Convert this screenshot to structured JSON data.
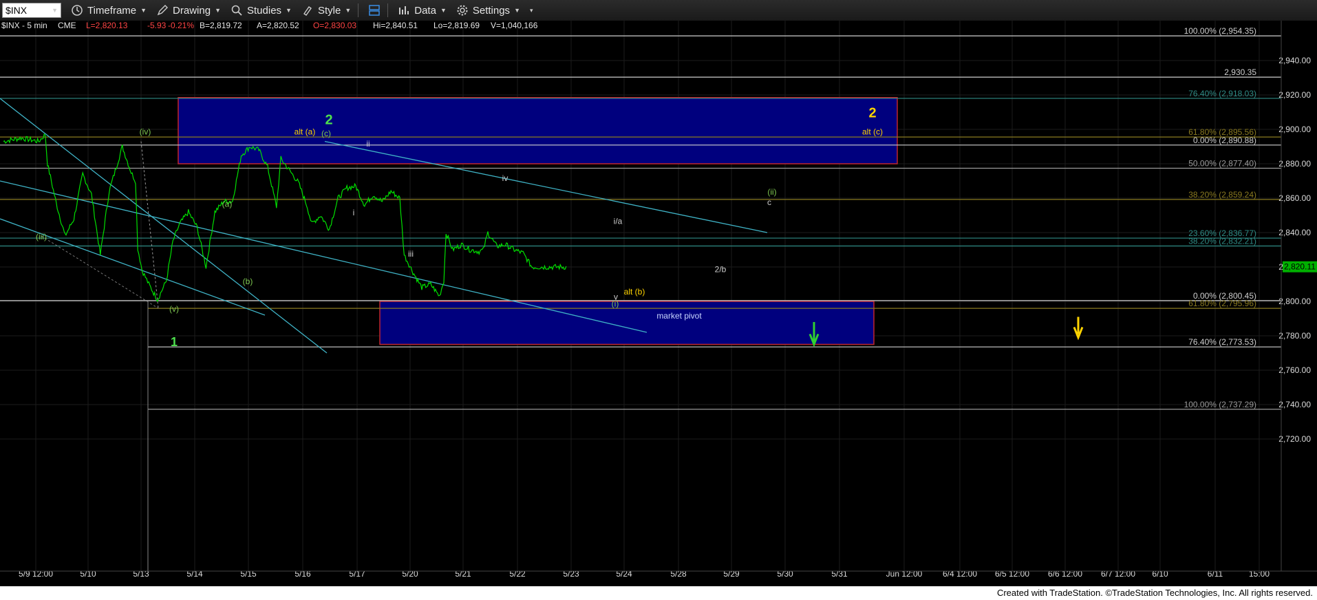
{
  "toolbar": {
    "symbol": "$INX",
    "timeframe": "Timeframe",
    "drawing": "Drawing",
    "studies": "Studies",
    "style": "Style",
    "data": "Data",
    "settings": "Settings"
  },
  "header": {
    "symbol_tf": "$INX - 5 min",
    "exchange": "CME",
    "last": "L=2,820.13",
    "change": "-5.93",
    "pct": "-0.21%",
    "bid": "B=2,819.72",
    "ask": "A=2,820.52",
    "open": "O=2,830.03",
    "high": "Hi=2,840.51",
    "low": "Lo=2,819.69",
    "volume": "V=1,040,166"
  },
  "footer": "Created with TradeStation. ©TradeStation Technologies, Inc. All rights reserved.",
  "colors": {
    "price": "#00e000",
    "trend": "#3fb3c6",
    "box": "#00007e",
    "boxBorder": "#c0262f",
    "fibGray": "#9a9a9a",
    "fibTeal": "#2f8c86",
    "fibOlive": "#8a7a20",
    "fibWhite": "#cfcfcf",
    "green": "#7ec850",
    "yellow": "#ffd400"
  },
  "chart_data": {
    "type": "line",
    "title": "$INX - 5 min",
    "ylim": [
      2705,
      2970
    ],
    "x_ticks": [
      "5/9 12:00",
      "5/10",
      "5/13",
      "5/14",
      "5/15",
      "5/16",
      "5/17",
      "5/20",
      "5/21",
      "5/22",
      "5/23",
      "5/24",
      "5/28",
      "5/29",
      "5/30",
      "5/31",
      "Jun 12:00",
      "6/4 12:00",
      "6/5 12:00",
      "6/6 12:00",
      "6/7 12:00",
      "6/10",
      "6/11",
      "15:00"
    ],
    "y_ticks": [
      2720,
      2740,
      2760,
      2780,
      2800,
      2820,
      2840,
      2860,
      2880,
      2900,
      2920,
      2940
    ],
    "y_tick_labels": [
      "2,720.00",
      "2,740.00",
      "2,760.00",
      "2,780.00",
      "2,800.00",
      "2,820.00",
      "2,840.00",
      "2,860.00",
      "2,880.00",
      "2,900.00",
      "2,920.00",
      "2,940.00"
    ],
    "last_price": 2820.11,
    "last_price_label": "2,820.11",
    "series": [
      {
        "x": [
          0.0,
          0.4,
          0.8,
          0.95,
          1.0,
          1.2,
          1.4,
          1.6,
          1.8,
          2.0,
          2.2,
          2.4,
          2.7,
          2.9,
          3.0,
          3.05,
          3.15,
          3.3,
          3.5,
          3.7,
          3.85,
          4.0,
          4.2,
          4.4,
          4.6,
          4.8,
          5.0,
          5.2,
          5.4,
          5.6,
          5.8,
          6.0,
          6.2,
          6.3,
          6.5,
          6.7,
          6.9,
          7.0,
          7.2,
          7.4,
          7.6,
          7.8,
          8.0,
          8.2,
          8.4,
          8.6,
          8.8,
          9.0,
          9.1,
          9.3,
          9.5,
          9.7,
          9.9,
          10.0,
          10.05,
          10.2,
          10.4,
          10.6,
          10.8,
          10.9,
          11.0,
          11.2,
          11.4,
          11.6,
          11.8,
          12.0,
          12.2,
          12.4,
          12.6,
          12.8
        ],
        "y": [
          2893,
          2895,
          2893,
          2897,
          2880,
          2857,
          2838,
          2848,
          2874,
          2862,
          2827,
          2864,
          2890,
          2875,
          2870,
          2831,
          2818,
          2810,
          2801,
          2812,
          2835,
          2845,
          2852,
          2843,
          2820,
          2852,
          2858,
          2858,
          2885,
          2890,
          2888,
          2878,
          2855,
          2883,
          2876,
          2869,
          2855,
          2845,
          2850,
          2842,
          2860,
          2866,
          2867,
          2856,
          2862,
          2858,
          2864,
          2860,
          2827,
          2817,
          2808,
          2810,
          2803,
          2812,
          2840,
          2830,
          2833,
          2830,
          2829,
          2830,
          2840,
          2832,
          2833,
          2830,
          2828,
          2820,
          2820,
          2820,
          2820,
          2820
        ],
        "x_note": "x positions measured in trading-session units from first plotted bar"
      }
    ],
    "fib_levels": [
      {
        "label": "100.00% (2,954.35)",
        "value": 2954.35
      },
      {
        "label": "2,930.35",
        "value": 2930.35
      },
      {
        "label": "76.40% (2,918.03)",
        "value": 2918.03
      },
      {
        "label": "61.80% (2,895.56)",
        "value": 2895.56
      },
      {
        "label": "0.00% (2,890.88)",
        "value": 2890.88
      },
      {
        "label": "50.00% (2,877.40)",
        "value": 2877.4
      },
      {
        "label": "38.20% (2,859.24)",
        "value": 2859.24
      },
      {
        "label": "23.60% (2,836.77)",
        "value": 2836.77
      },
      {
        "label": "38.20% (2,832.21)",
        "value": 2832.21
      },
      {
        "label": "0.00% (2,800.45)",
        "value": 2800.45
      },
      {
        "label": "61.80% (2,795.96)",
        "value": 2795.96
      },
      {
        "label": "76.40% (2,773.53)",
        "value": 2773.53
      },
      {
        "label": "100.00% (2,737.29)",
        "value": 2737.29
      }
    ],
    "annotations": [
      "(iii)",
      "(iv)",
      "(v)",
      "1",
      "(a)",
      "(b)",
      "alt (a)",
      "2",
      "(c)",
      "ii",
      "i",
      "iii",
      "iv",
      "(ii)",
      "c",
      "i/a",
      "2/b",
      "v",
      "alt (b)",
      "(i)",
      "market pivot",
      "2",
      "alt (c)"
    ]
  }
}
